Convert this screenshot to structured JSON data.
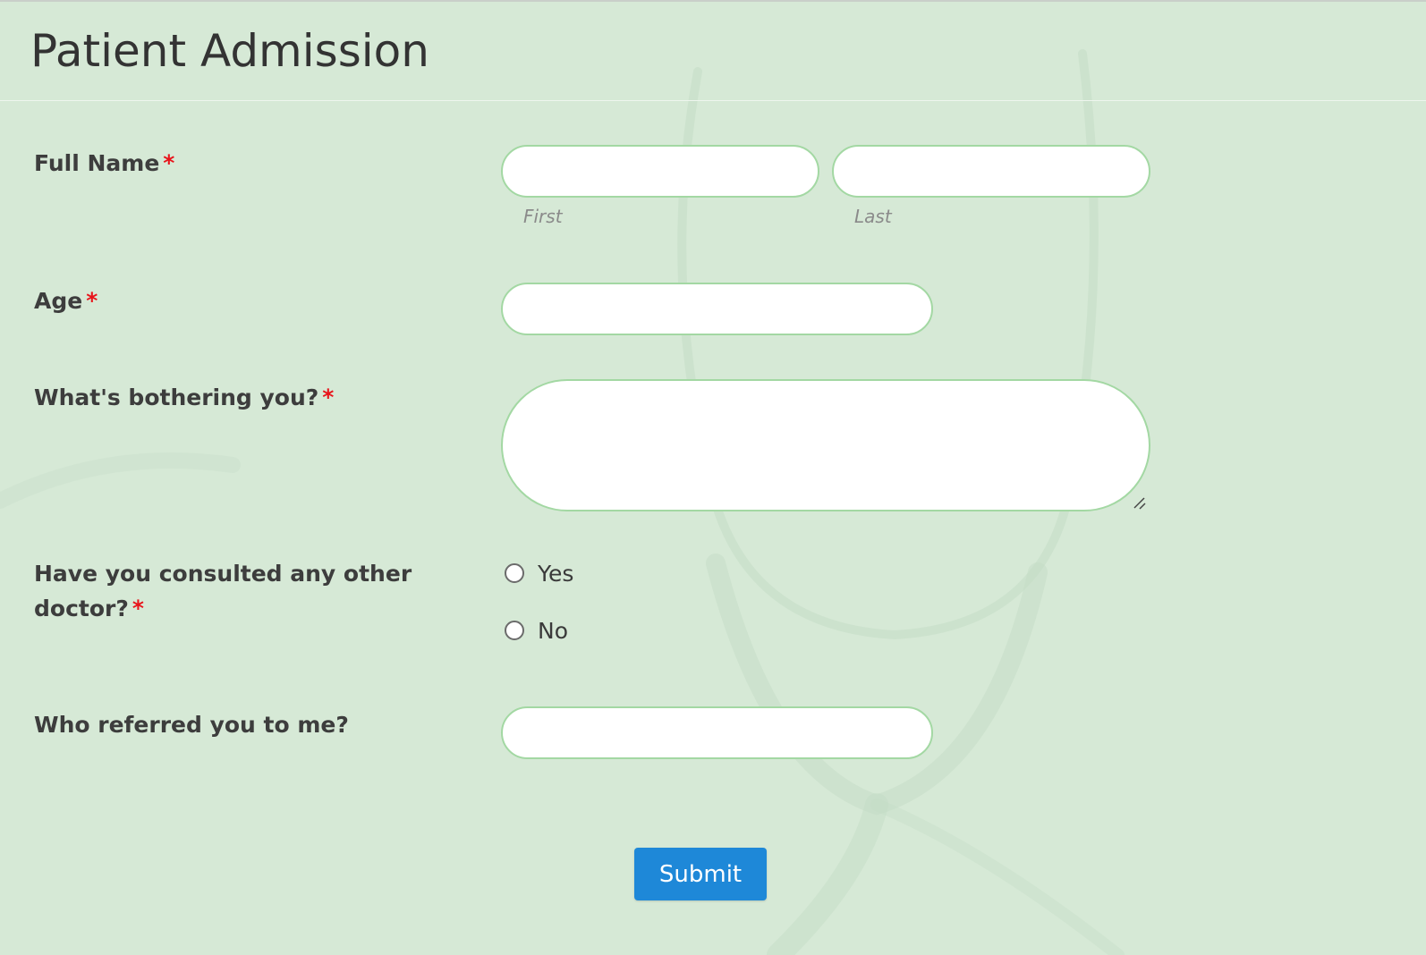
{
  "form": {
    "title": "Patient Admission",
    "full_name": {
      "label": "Full Name",
      "required_mark": "*",
      "first_value": "",
      "last_value": "",
      "first_sublabel": "First",
      "last_sublabel": "Last"
    },
    "age": {
      "label": "Age",
      "required_mark": "*",
      "value": ""
    },
    "bothering": {
      "label": "What's bothering you?",
      "required_mark": "*",
      "value": ""
    },
    "consulted": {
      "label": "Have you consulted any other doctor?",
      "required_mark": "*",
      "options": [
        "Yes",
        "No"
      ],
      "selected": null
    },
    "referred": {
      "label": "Who referred you to me?",
      "value": ""
    },
    "submit_label": "Submit"
  },
  "colors": {
    "background": "#d6e9d6",
    "field_border": "#a3d8a3",
    "required": "#e8141b",
    "button": "#1e88d8"
  },
  "icons": {
    "textarea_resize": "resize-grip-icon",
    "background_image": "stethoscope-watermark"
  }
}
